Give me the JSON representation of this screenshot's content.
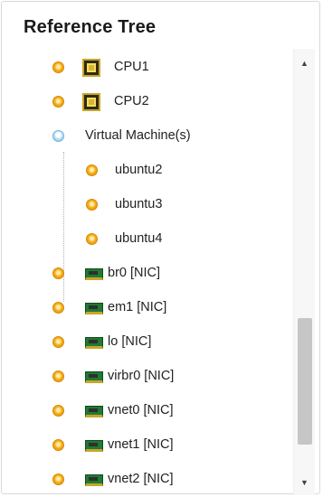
{
  "panel": {
    "title": "Reference Tree"
  },
  "tree": {
    "cpus": [
      {
        "label": "CPU1",
        "icon": "cpu-chip-icon"
      },
      {
        "label": "CPU2",
        "icon": "cpu-chip-icon"
      }
    ],
    "vm_group": {
      "label": "Virtual Machine(s)",
      "expanded": true,
      "children": [
        {
          "label": "ubuntu2"
        },
        {
          "label": "ubuntu3"
        },
        {
          "label": "ubuntu4"
        }
      ]
    },
    "nics": [
      {
        "label": "br0 [NIC]",
        "icon": "network-card-icon"
      },
      {
        "label": "em1 [NIC]",
        "icon": "network-card-icon"
      },
      {
        "label": "lo [NIC]",
        "icon": "network-card-icon"
      },
      {
        "label": "virbr0 [NIC]",
        "icon": "network-card-icon"
      },
      {
        "label": "vnet0 [NIC]",
        "icon": "network-card-icon"
      },
      {
        "label": "vnet1 [NIC]",
        "icon": "network-card-icon"
      },
      {
        "label": "vnet2 [NIC]",
        "icon": "network-card-icon"
      }
    ]
  },
  "scrollbar": {
    "up_icon": "scroll-up-arrow-icon",
    "down_icon": "scroll-down-arrow-icon"
  },
  "colors": {
    "leaf_bullet": "#f6b21e",
    "group_bullet": "#9fd0ec",
    "nic_green": "#1f7a33",
    "cpu_gold": "#c9a62a"
  }
}
